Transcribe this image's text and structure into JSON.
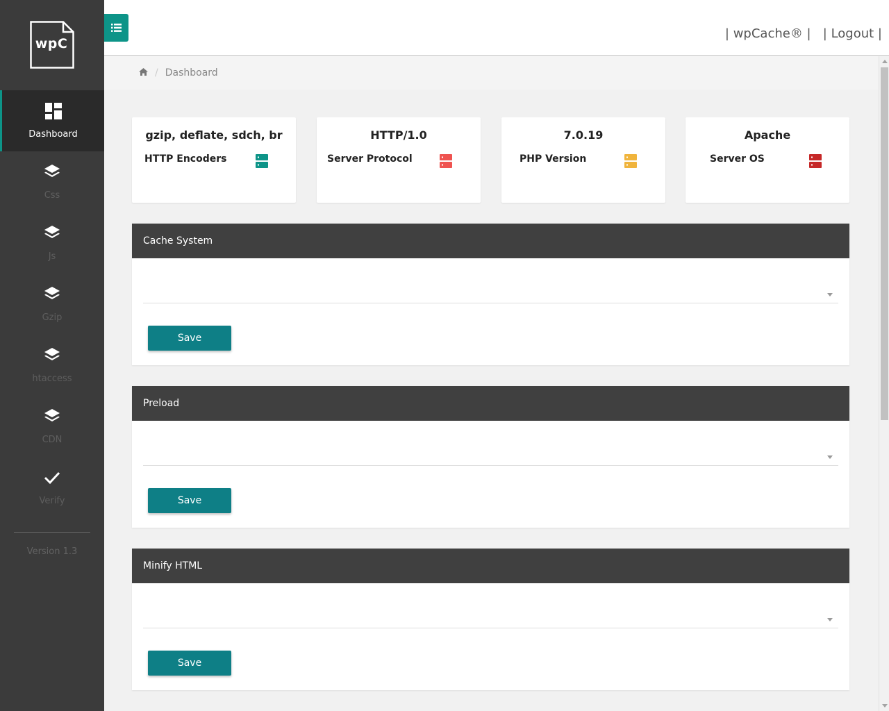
{
  "sidebar": {
    "logo_text": "wpC",
    "items": [
      {
        "label": "Dashboard",
        "icon": "dashboard-icon",
        "active": true
      },
      {
        "label": "Css",
        "icon": "layers-icon"
      },
      {
        "label": "Js",
        "icon": "layers-icon"
      },
      {
        "label": "Gzip",
        "icon": "layers-icon"
      },
      {
        "label": "htaccess",
        "icon": "layers-icon"
      },
      {
        "label": "CDN",
        "icon": "layers-icon"
      },
      {
        "label": "Verify",
        "icon": "check-icon"
      }
    ],
    "version": "Version 1.3"
  },
  "header": {
    "menu_icon": "list-icon",
    "brand_link": "| wpCache® |",
    "logout_link": "| Logout |"
  },
  "breadcrumb": {
    "home_icon": "home-icon",
    "current": "Dashboard"
  },
  "stats": [
    {
      "value": "gzip, deflate, sdch, br",
      "label": "HTTP Encoders",
      "icon": "server-icon",
      "color": "#0d9488"
    },
    {
      "value": "HTTP/1.0",
      "label": "Server Protocol",
      "icon": "server-icon",
      "color": "#ef5350"
    },
    {
      "value": "7.0.19",
      "label": "PHP Version",
      "icon": "server-icon",
      "color": "#f0b43c"
    },
    {
      "value": "Apache",
      "label": "Server OS",
      "icon": "server-icon",
      "color": "#c62828"
    }
  ],
  "panels": [
    {
      "title": "Cache System",
      "select_value": "",
      "save_label": "Save"
    },
    {
      "title": "Preload",
      "select_value": "",
      "save_label": "Save"
    },
    {
      "title": "Minify HTML",
      "select_value": "",
      "save_label": "Save"
    }
  ],
  "colors": {
    "accent": "#0d9488",
    "button": "#0e7f86",
    "sidebar": "#3b3b3b",
    "panel_header": "#404040"
  }
}
